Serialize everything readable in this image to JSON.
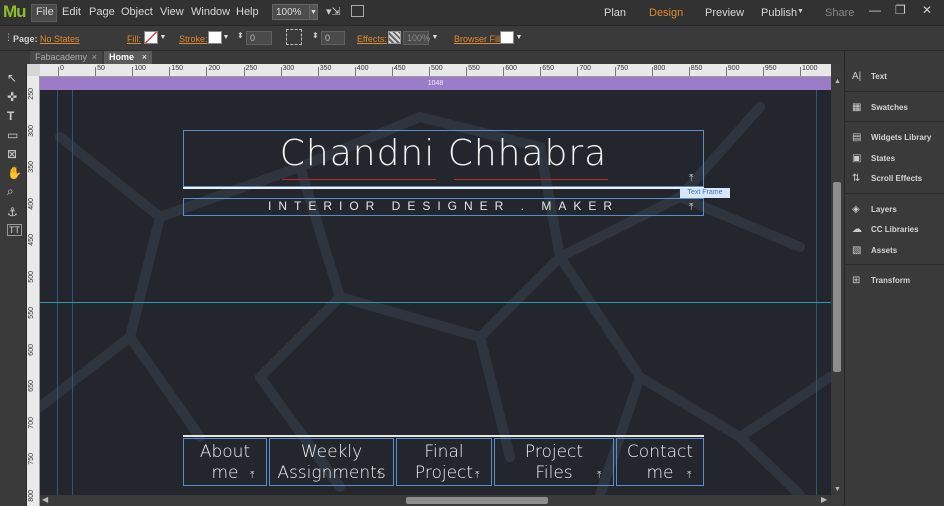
{
  "app": {
    "logo": "Mu"
  },
  "menu": [
    "File",
    "Edit",
    "Page",
    "Object",
    "View",
    "Window",
    "Help"
  ],
  "zoom": "100%",
  "modes": {
    "plan": "Plan",
    "design": "Design",
    "preview": "Preview",
    "publish": "Publish",
    "share": "Share"
  },
  "window": {
    "minimize": "—",
    "restore": "❐",
    "close": "✕"
  },
  "control_bar": {
    "page_label": "Page:",
    "page_value": "No States",
    "fill_label": "Fill:",
    "stroke_label": "Stroke:",
    "stroke_width": "0",
    "corner_value": "0",
    "effects_label": "Effects:",
    "opacity": "100%",
    "browser_fill_label": "Browser Fill:"
  },
  "tabs": [
    {
      "label": "Fabacademy",
      "close": "×"
    },
    {
      "label": "Home",
      "close": "×"
    }
  ],
  "ruler_h": [
    "0",
    "50",
    "100",
    "150",
    "200",
    "250",
    "300",
    "350",
    "400",
    "450",
    "500",
    "550",
    "600",
    "650",
    "700",
    "750",
    "800",
    "850",
    "900",
    "950",
    "1000"
  ],
  "ruler_v": [
    "250",
    "300",
    "350",
    "400",
    "450",
    "500",
    "550",
    "600",
    "650",
    "700",
    "750",
    "800"
  ],
  "page_width_label": "1048",
  "site": {
    "title": "Chandni Chhabra",
    "subtitle": "INTERIOR DESIGNER . MAKER",
    "text_frame_tag": "Text Frame",
    "nav": [
      {
        "line1": "About",
        "line2": "me"
      },
      {
        "line1": "Weekly",
        "line2": "Assignments"
      },
      {
        "line1": "Final",
        "line2": "Project"
      },
      {
        "line1": "Project",
        "line2": "Files"
      },
      {
        "line1": "Contact",
        "line2": "me"
      }
    ]
  },
  "panels": [
    "Text",
    "Swatches",
    "Widgets Library",
    "States",
    "Scroll Effects",
    "Layers",
    "CC Libraries",
    "Assets",
    "Transform"
  ],
  "colors": {
    "logo": "#8dbd2a",
    "design_active": "#e08a2e",
    "page_bar": "#9a7cc8",
    "frame_outline": "#5a8ec8",
    "guide": "#2a9ab0"
  }
}
